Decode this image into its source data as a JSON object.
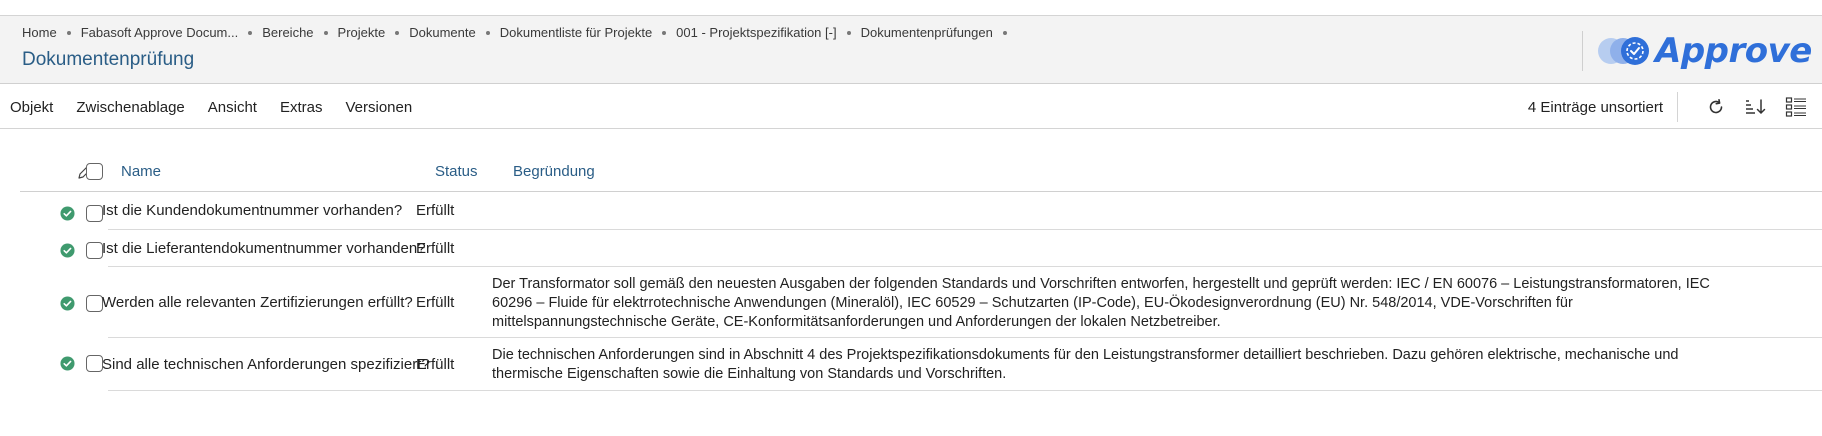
{
  "breadcrumb": [
    "Home",
    "Fabasoft Approve Docum...",
    "Bereiche",
    "Projekte",
    "Dokumente",
    "Dokumentliste für Projekte",
    "001 - Projektspezifikation [-]",
    "Dokumentenprüfungen"
  ],
  "page_title": "Dokumentenprüfung",
  "logo": {
    "text": "Approve",
    "color": "#2f6fd9"
  },
  "menu": [
    "Objekt",
    "Zwischenablage",
    "Ansicht",
    "Extras",
    "Versionen"
  ],
  "toolbar": {
    "entry_count": "4 Einträge unsortiert",
    "icons": [
      "refresh-icon",
      "sort-icon",
      "list-view-icon"
    ]
  },
  "columns": {
    "name": "Name",
    "status": "Status",
    "reason": "Begründung"
  },
  "rows": [
    {
      "name": "Ist die Kundendokumentnummer vorhanden?",
      "status": "Erfüllt",
      "reason": ""
    },
    {
      "name": "Ist die Lieferantendokumentnummer vorhanden?",
      "status": "Erfüllt",
      "reason": ""
    },
    {
      "name": "Werden alle relevanten Zertifizierungen erfüllt?",
      "status": "Erfüllt",
      "reason": "Der Transformator soll gemäß den neuesten Ausgaben der folgenden Standards und Vorschriften entworfen, hergestellt und geprüft werden: IEC / EN 60076 – Leistungstransformatoren, IEC 60296 – Fluide für elektrrotechnische Anwendungen (Mineralöl), IEC 60529 – Schutzarten (IP-Code), EU-Ökodesignverordnung (EU) Nr. 548/2014, VDE-Vorschriften für mittelspannungstechnische Geräte, CE-Konformitätsanforderungen und Anforderungen der lokalen Netzbetreiber."
    },
    {
      "name": "Sind alle technischen Anforderungen spezifiziert?",
      "status": "Erfüllt",
      "reason": "Die technischen Anforderungen sind in Abschnitt 4 des Projektspezifikationsdokuments für den Leistungstransformer detailliert beschrieben. Dazu gehören elektrische, mechanische und thermische Eigenschaften sowie die Einhaltung von Standards und Vorschriften."
    }
  ],
  "colors": {
    "accent": "#2a5d86",
    "status_ok": "#3f9a6e",
    "header_bg": "#f3f3f3"
  }
}
